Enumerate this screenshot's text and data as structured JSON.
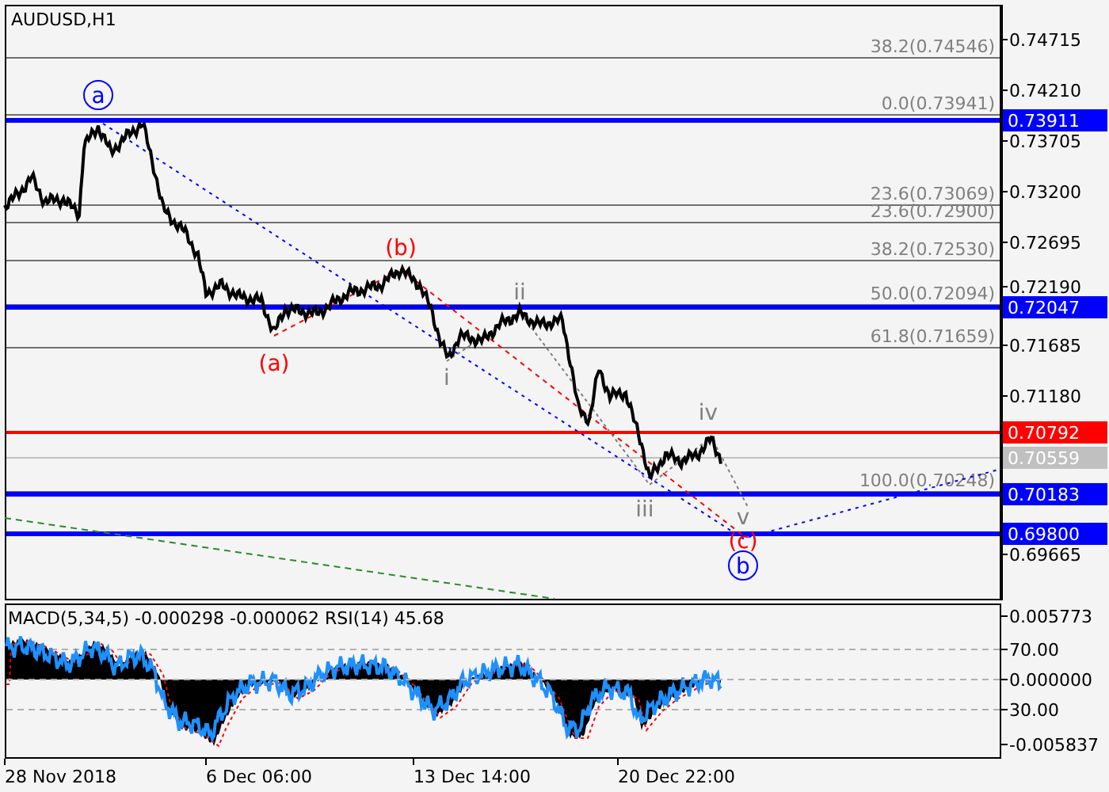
{
  "chart": {
    "title": "AUDUSD,H1",
    "price_axis": [
      "0.74715",
      "0.74210",
      "0.73705",
      "0.73200",
      "0.72695",
      "0.72190",
      "0.71685",
      "0.71180",
      "0.69665"
    ],
    "fibonacci_levels": [
      "38.2(0.74546)",
      "0.0(0.73941)",
      "23.6(0.73069)",
      "23.6(0.72900)",
      "38.2(0.72530)",
      "50.0(0.72094)",
      "61.8(0.71659)",
      "100.0(0.70248)"
    ],
    "price_tags": [
      {
        "text": "0.73911",
        "color": "#0000ff"
      },
      {
        "text": "0.72047",
        "color": "#0000ff"
      },
      {
        "text": "0.70792",
        "color": "#ff0000"
      },
      {
        "text": "0.70559",
        "color": "#c0c0c0"
      },
      {
        "text": "0.70183",
        "color": "#0000ff"
      },
      {
        "text": "0.69800",
        "color": "#0000ff"
      }
    ],
    "wave_labels": [
      {
        "text": "a",
        "kind": "circled",
        "color": "#0000ff"
      },
      {
        "text": "(b)",
        "kind": "plain",
        "color": "#ff0000"
      },
      {
        "text": "(a)",
        "kind": "plain",
        "color": "#ff0000"
      },
      {
        "text": "ii",
        "kind": "plain",
        "color": "#808080"
      },
      {
        "text": "i",
        "kind": "plain",
        "color": "#808080"
      },
      {
        "text": "iv",
        "kind": "plain",
        "color": "#808080"
      },
      {
        "text": "iii",
        "kind": "plain",
        "color": "#808080"
      },
      {
        "text": "v",
        "kind": "plain",
        "color": "#808080"
      },
      {
        "text": "(c)",
        "kind": "plain",
        "color": "#ff0000"
      },
      {
        "text": "b",
        "kind": "circled",
        "color": "#0000ff"
      }
    ]
  },
  "indicator": {
    "header": "MACD(5,34,5) -0.000298 -0.000062 RSI(14) 45.68",
    "axis": [
      "0.005773",
      "70.00",
      "0.000000",
      "30.00",
      "-0.005837"
    ]
  },
  "time_axis": [
    "28 Nov 2018",
    "6 Dec 06:00",
    "13 Dec 14:00",
    "20 Dec 22:00"
  ]
}
